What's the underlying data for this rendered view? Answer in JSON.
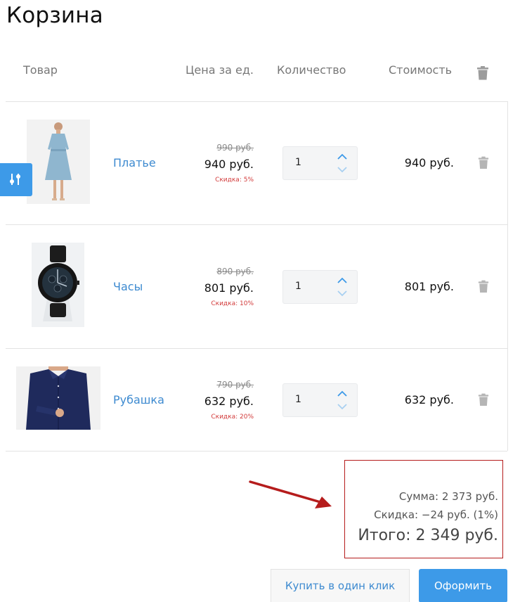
{
  "page": {
    "title": "Корзина"
  },
  "table_headers": {
    "product": "Товар",
    "unit_price": "Цена за ед.",
    "quantity": "Количество",
    "cost": "Стоимость"
  },
  "items": [
    {
      "name": "Платье",
      "old_price": "990 руб.",
      "price": "940 руб.",
      "discount": "Скидка: 5%",
      "quantity": "1",
      "cost": "940 руб."
    },
    {
      "name": "Часы",
      "old_price": "890 руб.",
      "price": "801 руб.",
      "discount": "Скидка: 10%",
      "quantity": "1",
      "cost": "801 руб."
    },
    {
      "name": "Рубашка",
      "old_price": "790 руб.",
      "price": "632 руб.",
      "discount": "Скидка: 20%",
      "quantity": "1",
      "cost": "632 руб."
    }
  ],
  "summary": {
    "sum": "Сумма: 2 373 руб.",
    "discount": "Скидка: −24 руб. (1%)",
    "total": "Итого: 2 349 руб."
  },
  "buttons": {
    "one_click": "Купить в один клик",
    "checkout": "Оформить"
  },
  "icons": {
    "delete": "trash-icon",
    "side_panel": "sliders-icon",
    "qty_up": "chevron-up-icon",
    "qty_down": "chevron-down-icon"
  },
  "colors": {
    "accent": "#3d9ae8",
    "link": "#3d8ad0",
    "discount": "#d23a3a",
    "annotation": "#b51c1c"
  }
}
